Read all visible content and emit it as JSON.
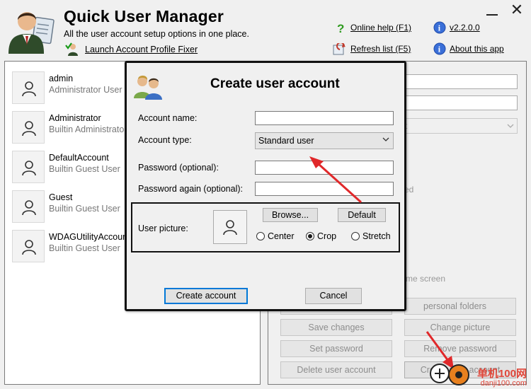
{
  "header": {
    "title": "Quick User Manager",
    "subtitle": "All the user account setup options in one place.",
    "fixer_link": "Launch Account Profile Fixer",
    "help_link": "Online help (F1)",
    "refresh_link": "Refresh list (F5)",
    "version_link": "v2.2.0.0",
    "about_link": "About this app"
  },
  "users": [
    {
      "name": "admin",
      "description": "Administrator User"
    },
    {
      "name": "Administrator",
      "description": "Builtin Administrator"
    },
    {
      "name": "DefaultAccount",
      "description": "Builtin Guest User"
    },
    {
      "name": "Guest",
      "description": "Builtin Guest User"
    },
    {
      "name": "WDAGUtilityAccount",
      "description": "Builtin Guest User"
    }
  ],
  "detail": {
    "combo_fragment": "t",
    "ed_fragment": "ed",
    "welcome_fragment": "me screen",
    "buttons": {
      "personal_folders": "personal folders",
      "save_changes": "Save changes",
      "change_picture": "Change picture",
      "set_password": "Set password",
      "remove_password": "Remove password",
      "delete_user": "Delete user account",
      "create_user": "Create user account"
    }
  },
  "dialog": {
    "title": "Create user account",
    "labels": {
      "account_name": "Account name:",
      "account_type": "Account type:",
      "password": "Password (optional):",
      "password_again": "Password again (optional):",
      "user_picture": "User picture:"
    },
    "account_name_value": "",
    "account_type_value": "Standard user",
    "password_value": "",
    "password_again_value": "",
    "browse_label": "Browse...",
    "default_label": "Default",
    "picture_fit_options": [
      "Center",
      "Crop",
      "Stretch"
    ],
    "picture_fit_selected": "Crop",
    "create_label": "Create account",
    "cancel_label": "Cancel"
  },
  "watermark": {
    "line1": "单机100网",
    "line2": "danji100.com"
  },
  "colors": {
    "annotation_red": "#e0282a",
    "link_blue": "#0a0a8a",
    "focus_blue": "#0078d7"
  }
}
